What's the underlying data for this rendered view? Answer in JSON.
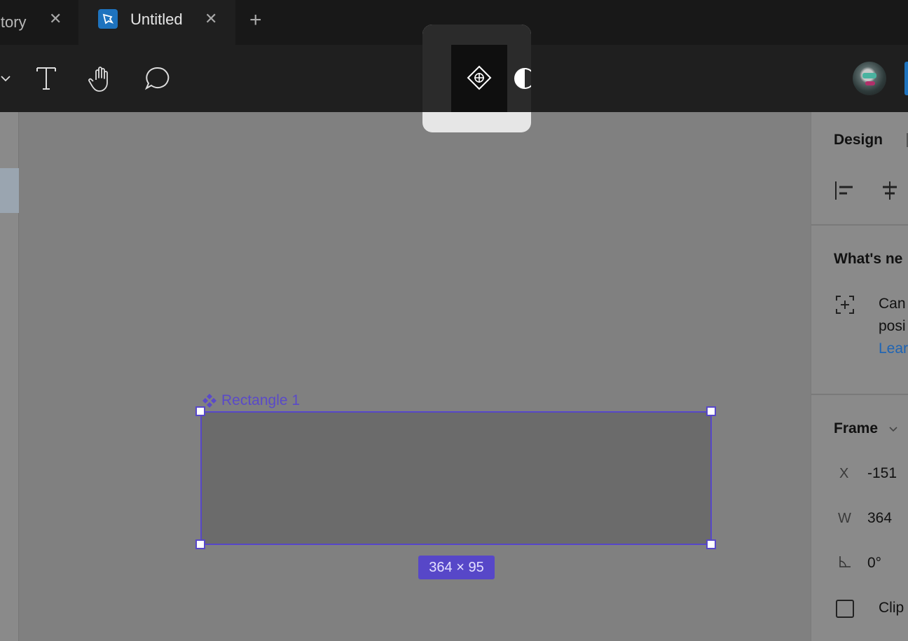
{
  "tabs": {
    "prev_label": "itory",
    "active_label": "Untitled",
    "close_glyph": "✕",
    "new_tab_glyph": "+"
  },
  "toolbar": {
    "tools": [
      "chevron-down-icon",
      "text-icon",
      "hand-icon",
      "comment-icon"
    ],
    "mode_popup": [
      "component-mode-icon",
      "contrast-mode-icon"
    ]
  },
  "canvas": {
    "layer_name": "Rectangle 1",
    "dimensions": "364 × 95",
    "selection_color": "#5747c8"
  },
  "design_panel": {
    "title": "Design",
    "whats_new_title": "What's ne",
    "whats_new_line1": "Can",
    "whats_new_line2": "posi",
    "whats_new_link": "Lear",
    "frame_title": "Frame",
    "fields": [
      {
        "label": "X",
        "value": "-151"
      },
      {
        "label": "W",
        "value": "364"
      },
      {
        "label": "rotation-icon",
        "value": "0°"
      }
    ],
    "clip_label": "Clip c"
  }
}
